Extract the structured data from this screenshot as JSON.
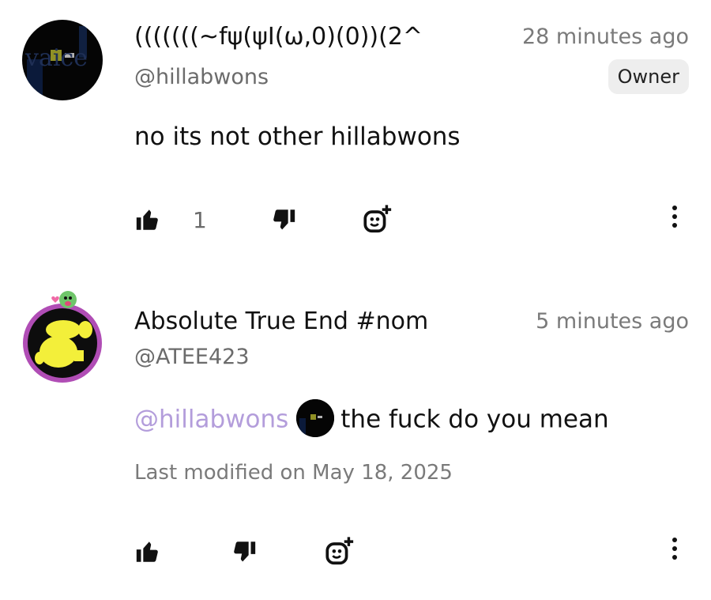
{
  "comments": [
    {
      "name": "(((((((~fψ(ψI(ω,0)(0))(2^",
      "time": "28 minutes ago",
      "handle": "@hillabwons",
      "badge": "Owner",
      "text": "no its not other hillabwons",
      "likes": "1",
      "avatar_text": "vaice"
    },
    {
      "name": "Absolute True End #nom",
      "time": "5 minutes ago",
      "handle": "@ATEE423",
      "mention": "@hillabwons",
      "text": "the fuck do you mean",
      "modified": "Last modified on May 18, 2025"
    }
  ],
  "colors": {
    "mention": "#b39ddb",
    "avatar_ring": "#b04db5",
    "avatar_fill": "#f3ef3a"
  },
  "icons": [
    "thumbs-up-icon",
    "thumbs-down-icon",
    "add-reaction-icon",
    "more-vertical-icon"
  ]
}
